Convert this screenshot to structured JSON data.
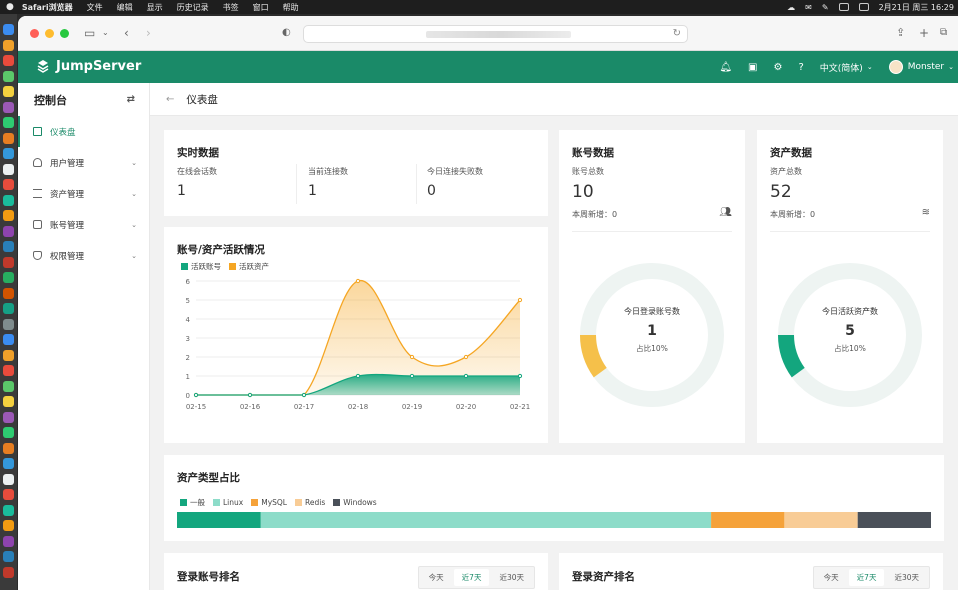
{
  "menubar": {
    "app": "Safari浏览器",
    "items": [
      "文件",
      "编辑",
      "显示",
      "历史记录",
      "书签",
      "窗口",
      "帮助"
    ],
    "datetime": "2月21日 周三  16:29"
  },
  "header": {
    "brand": "JumpServer",
    "language": "中文(简体)",
    "user": "Monster"
  },
  "sidebar": {
    "title": "控制台",
    "items": [
      {
        "label": "仪表盘"
      },
      {
        "label": "用户管理"
      },
      {
        "label": "资产管理"
      },
      {
        "label": "账号管理"
      },
      {
        "label": "权限管理"
      }
    ]
  },
  "page": {
    "title": "仪表盘"
  },
  "realtime": {
    "title": "实时数据",
    "stats": [
      {
        "label": "在线会话数",
        "value": "1"
      },
      {
        "label": "当前连接数",
        "value": "1"
      },
      {
        "label": "今日连接失败数",
        "value": "0"
      }
    ]
  },
  "accounts": {
    "title": "账号数据",
    "total_label": "账号总数",
    "total": "10",
    "week_label": "本周新增：",
    "week_value": "0",
    "donut_label": "今日登录账号数",
    "donut_value": "1",
    "donut_pct_text": "占比10%",
    "donut_fraction": 0.1,
    "color": "#f5c04a"
  },
  "assets": {
    "title": "资产数据",
    "total_label": "资产总数",
    "total": "52",
    "week_label": "本周新增：",
    "week_value": "0",
    "donut_label": "今日活跃资产数",
    "donut_value": "5",
    "donut_pct_text": "占比10%",
    "donut_fraction": 0.1,
    "color": "#13a67e"
  },
  "activity": {
    "title": "账号/资产活跃情况",
    "legend": [
      "活跃账号",
      "活跃资产"
    ]
  },
  "asset_types": {
    "title": "资产类型占比",
    "legend": [
      "一般",
      "Linux",
      "MySQL",
      "Redis",
      "Windows"
    ]
  },
  "login_account_rank": {
    "title": "登录账号排名",
    "tabs": [
      "今天",
      "近7天",
      "近30天"
    ],
    "active": 1
  },
  "login_asset_rank": {
    "title": "登录资产排名",
    "tabs": [
      "今天",
      "近7天",
      "近30天"
    ],
    "active": 1
  },
  "chart_data": [
    {
      "type": "area",
      "title": "账号/资产活跃情况",
      "categories": [
        "02-15",
        "02-16",
        "02-17",
        "02-18",
        "02-19",
        "02-20",
        "02-21"
      ],
      "ylim": [
        0,
        6
      ],
      "yticks": [
        0,
        1,
        2,
        3,
        4,
        5,
        6
      ],
      "series": [
        {
          "name": "活跃账号",
          "color": "#13a67e",
          "values": [
            0,
            0,
            0,
            1,
            1,
            1,
            1
          ]
        },
        {
          "name": "活跃资产",
          "color": "#f5a623",
          "values": [
            0,
            0,
            0,
            6,
            2,
            2,
            5
          ]
        }
      ],
      "grid": true,
      "legend": "top-left"
    },
    {
      "type": "bar",
      "title": "资产类型占比",
      "orientation": "stacked-horizontal",
      "categories": [
        "一般",
        "Linux",
        "MySQL",
        "Redis",
        "Windows"
      ],
      "values": [
        8,
        43,
        7,
        7,
        7
      ],
      "colors": [
        "#13a67e",
        "#8ddcc9",
        "#f5a23a",
        "#f8cc96",
        "#4a5059"
      ],
      "legend": "top-left"
    }
  ]
}
